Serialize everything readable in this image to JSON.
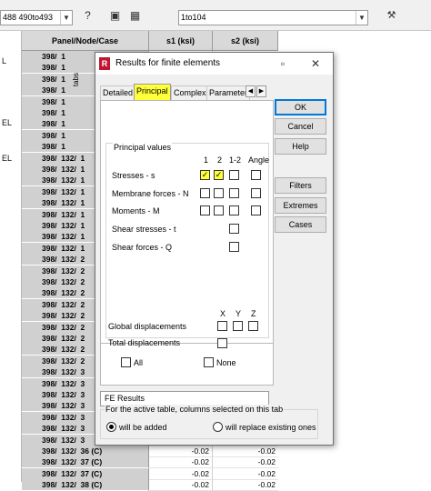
{
  "toolbar": {
    "combo_left": "488 490to493",
    "combo_right": "1to104",
    "icons": [
      "help-question-icon",
      "window-icon",
      "table-icon",
      "crane-icon"
    ]
  },
  "left_strip": {
    "labels": [
      "L",
      "EL",
      "EL"
    ]
  },
  "grid": {
    "headers": {
      "key": "Panel/Node/Case",
      "s1": "s1 (ksi)",
      "s2": "s2 (ksi)"
    },
    "rows": [
      {
        "key": "398/  1",
        "s1": "",
        "s2": ""
      },
      {
        "key": "398/  1",
        "s1": "",
        "s2": ""
      },
      {
        "key": "398/  1",
        "s1": "",
        "s2": ""
      },
      {
        "key": "398/  1",
        "s1": "",
        "s2": ""
      },
      {
        "key": "398/  1",
        "s1": "",
        "s2": ""
      },
      {
        "key": "398/  1",
        "s1": "",
        "s2": ""
      },
      {
        "key": "398/  1",
        "s1": "",
        "s2": ""
      },
      {
        "key": "398/  1",
        "s1": "",
        "s2": ""
      },
      {
        "key": "398/  1",
        "s1": "",
        "s2": ""
      },
      {
        "key": "398/  132/  1",
        "s1": "",
        "s2": ""
      },
      {
        "key": "398/  132/  1",
        "s1": "",
        "s2": ""
      },
      {
        "key": "398/  132/  1",
        "s1": "",
        "s2": ""
      },
      {
        "key": "398/  132/  1",
        "s1": "",
        "s2": ""
      },
      {
        "key": "398/  132/  1",
        "s1": "",
        "s2": ""
      },
      {
        "key": "398/  132/  1",
        "s1": "",
        "s2": ""
      },
      {
        "key": "398/  132/  1",
        "s1": "",
        "s2": ""
      },
      {
        "key": "398/  132/  1",
        "s1": "",
        "s2": ""
      },
      {
        "key": "398/  132/  1",
        "s1": "",
        "s2": ""
      },
      {
        "key": "398/  132/  2",
        "s1": "",
        "s2": ""
      },
      {
        "key": "398/  132/  2",
        "s1": "",
        "s2": ""
      },
      {
        "key": "398/  132/  2",
        "s1": "",
        "s2": ""
      },
      {
        "key": "398/  132/  2",
        "s1": "",
        "s2": ""
      },
      {
        "key": "398/  132/  2",
        "s1": "",
        "s2": ""
      },
      {
        "key": "398/  132/  2",
        "s1": "",
        "s2": ""
      },
      {
        "key": "398/  132/  2",
        "s1": "",
        "s2": ""
      },
      {
        "key": "398/  132/  2",
        "s1": "",
        "s2": ""
      },
      {
        "key": "398/  132/  2",
        "s1": "",
        "s2": ""
      },
      {
        "key": "398/  132/  2",
        "s1": "",
        "s2": ""
      },
      {
        "key": "398/  132/  3",
        "s1": "",
        "s2": ""
      },
      {
        "key": "398/  132/  3",
        "s1": "",
        "s2": ""
      },
      {
        "key": "398/  132/  3",
        "s1": "",
        "s2": ""
      },
      {
        "key": "398/  132/  3",
        "s1": "",
        "s2": ""
      },
      {
        "key": "398/  132/  3",
        "s1": "",
        "s2": ""
      },
      {
        "key": "398/  132/  3",
        "s1": "",
        "s2": ""
      },
      {
        "key": "398/  132/  3",
        "s1": "",
        "s2": ""
      },
      {
        "key": "398/  132/  36 (C)",
        "s1": "-0.02",
        "s2": "-0.02"
      },
      {
        "key": "398/  132/  37 (C)",
        "s1": "-0.02",
        "s2": "-0.02"
      },
      {
        "key": "398/  132/  37 (C)",
        "s1": "-0.02",
        "s2": "-0.02"
      },
      {
        "key": "398/  132/  38 (C)",
        "s1": "-0.02",
        "s2": "-0.02"
      }
    ]
  },
  "dialog": {
    "title": "Results for finite elements",
    "tabs": [
      "Detailed",
      "Principal",
      "Complex",
      "Parameter"
    ],
    "tabs_label": "tabs",
    "group_title": "Principal values",
    "col_headers": [
      "1",
      "2",
      "1-2",
      "Angle"
    ],
    "rows": [
      {
        "label": "Stresses - s",
        "checks": [
          true,
          true,
          false,
          false
        ]
      },
      {
        "label": "Membrane forces - N",
        "checks": [
          false,
          false,
          false,
          false
        ]
      },
      {
        "label": "Moments - M",
        "checks": [
          false,
          false,
          false,
          false
        ]
      },
      {
        "label": "Shear stresses - t",
        "checks": [
          false
        ]
      },
      {
        "label": "Shear forces - Q",
        "checks": [
          false
        ]
      }
    ],
    "xyz": [
      "X",
      "Y",
      "Z"
    ],
    "global_disp": "Global displacements",
    "total_disp": "Total displacements",
    "all_label": "All",
    "none_label": "None",
    "buttons": {
      "ok": "OK",
      "cancel": "Cancel",
      "help": "Help",
      "filters": "Filters",
      "extremes": "Extremes",
      "cases": "Cases"
    },
    "name_value": "FE Results",
    "bottom_title": "For the active table, columns selected on this tab",
    "radio_added": "will be added",
    "radio_replace": "will replace existing ones",
    "highlight_color": "#ffff3a"
  }
}
